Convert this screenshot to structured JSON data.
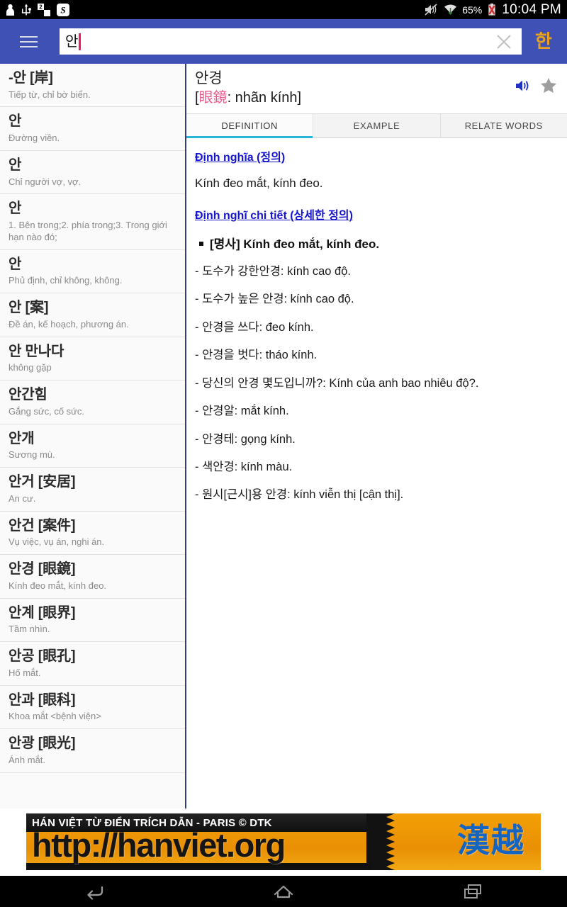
{
  "statusbar": {
    "icons": [
      "person-icon",
      "usb-icon",
      "sim2-icon",
      "s-badge-icon"
    ],
    "right_icons": [
      "mute-icon",
      "wifi-icon",
      "battery-low-icon"
    ],
    "battery": "65%",
    "clock": "10:04 PM"
  },
  "appbar": {
    "menu_icon": "hamburger-icon",
    "search_value": "안",
    "search_placeholder": "",
    "clear_icon": "close-icon",
    "lang_label": "한",
    "bg_color": "#3f51b5",
    "lang_color": "#e8a020"
  },
  "list": {
    "items": [
      {
        "head": "-안 [岸]",
        "sub": "Tiếp từ, chỉ bờ biển."
      },
      {
        "head": "안",
        "sub": "Đường viền."
      },
      {
        "head": "안",
        "sub": "Chỉ người vợ, vợ."
      },
      {
        "head": "안",
        "sub": "1. Bên trong;2. phía trong;3. Trong giới hạn nào đó;"
      },
      {
        "head": "안",
        "sub": "Phủ định, chỉ không, không."
      },
      {
        "head": "안 [案]",
        "sub": "Đề án, kế hoạch, phương án."
      },
      {
        "head": "안 만나다",
        "sub": "không gặp"
      },
      {
        "head": "안간힘",
        "sub": "Gắng sức, cố sức."
      },
      {
        "head": "안개",
        "sub": "Sương mù."
      },
      {
        "head": "안거 [安居]",
        "sub": "An cư."
      },
      {
        "head": "안건 [案件]",
        "sub": "Vụ việc, vụ án, nghi án."
      },
      {
        "head": "안경 [眼鏡]",
        "sub": "Kính đeo mắt, kính đeo."
      },
      {
        "head": "안계 [眼界]",
        "sub": "Tầm nhìn."
      },
      {
        "head": "안공 [眼孔]",
        "sub": "Hố mắt."
      },
      {
        "head": "안과 [眼科]",
        "sub": "Khoa mắt <bệnh viện>"
      },
      {
        "head": "안광 [眼光]",
        "sub": "Ánh mắt."
      }
    ]
  },
  "detail": {
    "word": "안경",
    "hanja": "眼鏡",
    "hanja_open": "[",
    "hanja_reading": ": nhãn kính]",
    "hanja_color": "#ef5a8c",
    "speaker_icon": "speaker-icon",
    "star_icon": "star-icon",
    "tabs": [
      {
        "label": "DEFINITION",
        "active": true
      },
      {
        "label": "EXAMPLE",
        "active": false
      },
      {
        "label": "RELATE WORDS",
        "active": false
      }
    ],
    "active_tab_color": "#29b6d8",
    "section1_title": "Định nghĩa (정의)",
    "section1_text": "Kính đeo mắt, kính đeo.",
    "section2_title": "Định nghĩ chi tiết (상세한 정의)",
    "pos_line": "[명사] Kính đeo mắt, kính đeo.",
    "examples": [
      "- 도수가 강한안경: kính cao độ.",
      "- 도수가 높은 안경: kính cao độ.",
      "- 안경을 쓰다: đeo kính.",
      "- 안경을 벗다: tháo kính.",
      "- 당신의 안경 몇도입니까?: Kính của anh bao nhiêu độ?.",
      "- 안경알: mắt kính.",
      "- 안경테: gọng kính.",
      "- 색안경: kính màu.",
      "- 원시[근시]용 안경: kính viễn thị [cận thị]."
    ]
  },
  "banner": {
    "headline": "HÁN VIỆT TỪ ĐIỂN TRÍCH DẪN - PARIS © DTK",
    "url": "http://hanviet.org",
    "cjk": "漢越",
    "bg_color": "#ec9405",
    "cjk_color": "#1565c0"
  },
  "navbar": {
    "back_icon": "back-icon",
    "home_icon": "home-icon",
    "recents_icon": "recents-icon"
  }
}
